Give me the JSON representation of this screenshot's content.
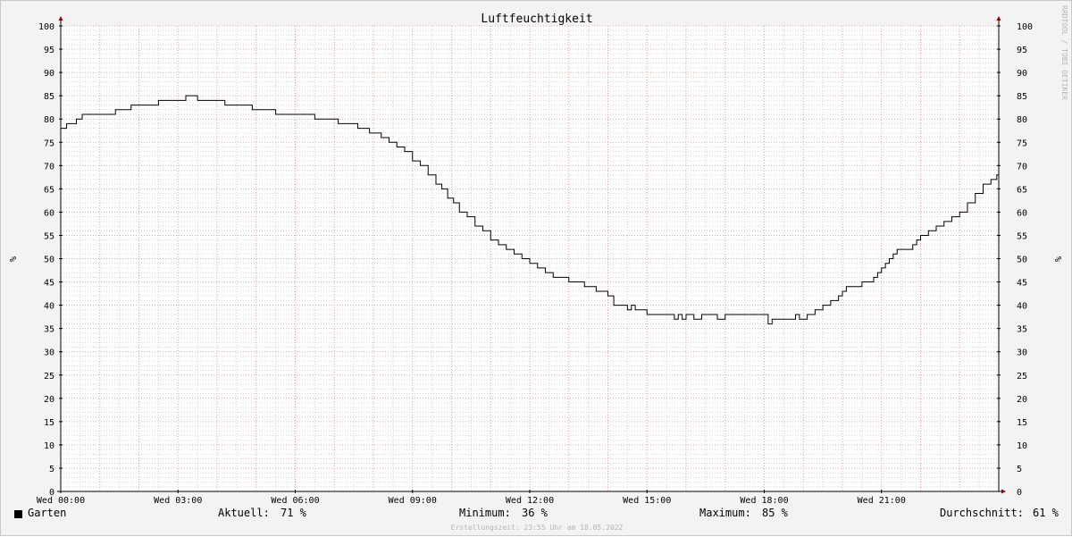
{
  "chart_data": {
    "type": "line",
    "title": "Luftfeuchtigkeit",
    "ylabel": "%",
    "ylim": [
      0,
      100
    ],
    "yticks": [
      0,
      5,
      10,
      15,
      20,
      25,
      30,
      35,
      40,
      45,
      50,
      55,
      60,
      65,
      70,
      75,
      80,
      85,
      90,
      95,
      100
    ],
    "ytick_labels": [
      "0",
      "5",
      "10",
      "15",
      "20",
      "25",
      "30",
      "35",
      "40",
      "45",
      "50",
      "55",
      "60",
      "65",
      "70",
      "75",
      "80",
      "85",
      "90",
      "95",
      "100"
    ],
    "xlim_hours": [
      0,
      24
    ],
    "xticks": [
      {
        "hour": 0,
        "label": "Wed 00:00"
      },
      {
        "hour": 3,
        "label": "Wed 03:00"
      },
      {
        "hour": 6,
        "label": "Wed 06:00"
      },
      {
        "hour": 9,
        "label": "Wed 09:00"
      },
      {
        "hour": 12,
        "label": "Wed 12:00"
      },
      {
        "hour": 15,
        "label": "Wed 15:00"
      },
      {
        "hour": 18,
        "label": "Wed 18:00"
      },
      {
        "hour": 21,
        "label": "Wed 21:00"
      }
    ],
    "grid": true,
    "colors": {
      "line": "#000000",
      "major_grid": "#e8a0a0",
      "minor_grid": "#d4d4d4",
      "axis": "#000000",
      "arrow": "#990000",
      "canvas": "#ffffff",
      "background": "#f3f3f3"
    },
    "series": [
      {
        "name": "Garten",
        "style": "step",
        "x_hours": [
          0.0,
          0.15,
          0.4,
          0.55,
          1.4,
          1.8,
          2.5,
          3.2,
          3.5,
          4.2,
          4.9,
          5.5,
          6.5,
          7.1,
          7.6,
          7.9,
          8.2,
          8.4,
          8.6,
          8.8,
          9.0,
          9.2,
          9.4,
          9.6,
          9.75,
          9.9,
          10.05,
          10.2,
          10.4,
          10.6,
          10.8,
          11.0,
          11.2,
          11.4,
          11.6,
          11.8,
          12.0,
          12.2,
          12.4,
          12.6,
          13.0,
          13.4,
          13.7,
          14.0,
          14.15,
          14.5,
          14.6,
          14.7,
          15.0,
          15.7,
          15.8,
          15.9,
          16.0,
          16.2,
          16.4,
          16.8,
          17.0,
          18.1,
          18.2,
          18.8,
          18.9,
          19.1,
          19.3,
          19.5,
          19.7,
          19.9,
          20.0,
          20.1,
          20.5,
          20.8,
          20.9,
          21.0,
          21.1,
          21.2,
          21.3,
          21.4,
          21.8,
          21.9,
          22.0,
          22.2,
          22.4,
          22.6,
          22.8,
          23.0,
          23.2,
          23.4,
          23.6,
          23.8,
          23.95,
          24.0
        ],
        "values": [
          78,
          79,
          80,
          81,
          82,
          83,
          84,
          85,
          84,
          83,
          82,
          81,
          80,
          79,
          78,
          77,
          76,
          75,
          74,
          73,
          71,
          70,
          68,
          66,
          65,
          63,
          62,
          60,
          59,
          57,
          56,
          54,
          53,
          52,
          51,
          50,
          49,
          48,
          47,
          46,
          45,
          44,
          43,
          42,
          40,
          39,
          40,
          39,
          38,
          37,
          38,
          37,
          38,
          37,
          38,
          37,
          38,
          36,
          37,
          38,
          37,
          38,
          39,
          40,
          41,
          42,
          43,
          44,
          45,
          46,
          47,
          48,
          49,
          50,
          51,
          52,
          53,
          54,
          55,
          56,
          57,
          58,
          59,
          60,
          62,
          64,
          66,
          67,
          68,
          69,
          70,
          71
        ]
      }
    ],
    "legend": {
      "series_label": "Garten",
      "stats": [
        {
          "label": "Aktuell:",
          "value": "71 %"
        },
        {
          "label": "Minimum:",
          "value": "36 %"
        },
        {
          "label": "Maximum:",
          "value": "85 %"
        },
        {
          "label": "Durchschnitt:",
          "value": "61 %"
        }
      ]
    },
    "watermark": "RRDTOOL / TOBI OETIKER",
    "footer": "Erstellungszeit: 23:55 Uhr am 18.05.2022"
  }
}
